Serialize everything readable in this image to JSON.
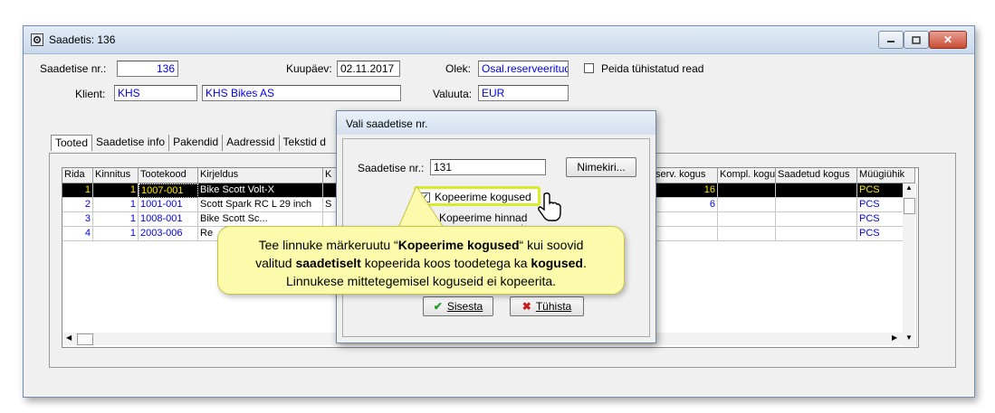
{
  "window": {
    "title": "Saadetis: 136",
    "icon": "settings-gear-icon"
  },
  "header": {
    "saadetise_nr_label": "Saadetise nr.:",
    "saadetise_nr_value": "136",
    "kuupaev_label": "Kuupäev:",
    "kuupaev_value": "02.11.2017",
    "olek_label": "Olek:",
    "olek_value": "Osal.reserveeritud",
    "peida_label": "Peida tühistatud read",
    "klient_label": "Klient:",
    "klient_code": "KHS",
    "klient_name": "KHS Bikes AS",
    "valuuta_label": "Valuuta:",
    "valuuta_value": "EUR"
  },
  "tabs": [
    "Tooted",
    "Saadetise info",
    "Pakendid",
    "Aadressid",
    "Tekstid d"
  ],
  "grid": {
    "columns_left": [
      "Rida",
      "Kinnitus",
      "Tootekood",
      "Kirjeldus",
      "K"
    ],
    "columns_right": [
      "serv. kogus",
      "Kompl. kogu",
      "Saadetud kogus",
      "Müügiühik"
    ],
    "rows": [
      {
        "rida": "1",
        "kinnitus": "1",
        "tootekood": "1007-001",
        "kirjeldus": "Bike Scott Volt-X",
        "k": "",
        "rserv": "16",
        "unit": "PCS",
        "selected": true
      },
      {
        "rida": "2",
        "kinnitus": "1",
        "tootekood": "1001-001",
        "kirjeldus": "Scott Spark RC L 29 inch",
        "k": "S",
        "rserv": "6",
        "unit": "PCS",
        "selected": false
      },
      {
        "rida": "3",
        "kinnitus": "1",
        "tootekood": "1008-001",
        "kirjeldus": "Bike Scott Sc...",
        "k": "",
        "rserv": "",
        "unit": "PCS",
        "selected": false
      },
      {
        "rida": "4",
        "kinnitus": "1",
        "tootekood": "2003-006",
        "kirjeldus": "Re",
        "k": "",
        "rserv": "",
        "unit": "PCS",
        "selected": false
      }
    ]
  },
  "dialog": {
    "title": "Vali saadetise nr.",
    "nr_label": "Saadetise nr.:",
    "nr_value": "131",
    "nimekiri_button": "Nimekiri...",
    "kopeeri_kogused_label": "Kopeerime kogused",
    "kopeeri_hinnad_label": "Kopeerime hinnad",
    "sisesta_button": "Sisesta",
    "tuhista_button": "Tühista"
  },
  "callout": {
    "line1_a": "Tee linnuke märkeruutu “",
    "line1_b": "Kopeerime kogused",
    "line1_c": "“ kui soovid",
    "line2_a": "valitud ",
    "line2_b": "saadetiselt",
    "line2_c": " kopeerida koos toodetega ka ",
    "line2_d": "kogused",
    "line2_e": ".",
    "line3": "Linnukese mittetegemisel koguseid ei kopeerita."
  },
  "colors": {
    "selected_row_bg": "#000000",
    "selected_row_fg": "#ffea00",
    "link_blue": "#0000ee",
    "callout_bg": "#fcfbab",
    "highlight": "#d9ec2c"
  }
}
